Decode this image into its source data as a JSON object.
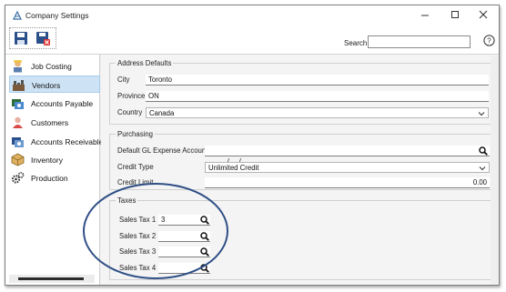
{
  "window": {
    "title": "Company Settings",
    "minimize_icon": "minimize-icon",
    "maximize_icon": "maximize-icon",
    "close_icon": "close-icon"
  },
  "toolbar": {
    "save_icon": "save-icon",
    "save_close_icon": "save-and-close-icon",
    "search_label": "Search",
    "search_value": "",
    "help_icon": "help-icon"
  },
  "sidebar": {
    "items": [
      {
        "label": "Job Costing",
        "icon": "job-costing-icon"
      },
      {
        "label": "Vendors",
        "icon": "vendors-icon",
        "selected": true
      },
      {
        "label": "Accounts Payable",
        "icon": "accounts-payable-icon"
      },
      {
        "label": "Customers",
        "icon": "customers-icon"
      },
      {
        "label": "Accounts Receivable",
        "icon": "accounts-receivable-icon"
      },
      {
        "label": "Inventory",
        "icon": "inventory-icon"
      },
      {
        "label": "Production",
        "icon": "production-icon"
      }
    ]
  },
  "address_defaults": {
    "title": "Address Defaults",
    "city_label": "City",
    "city_value": "Toronto",
    "province_label": "Province",
    "province_value": "ON",
    "country_label": "Country",
    "country_value": "Canada"
  },
  "purchasing": {
    "title": "Purchasing",
    "gl_label": "Default GL Expense Account",
    "gl_value": "  /     /",
    "credit_type_label": "Credit Type",
    "credit_type_value": "Unlimited Credit",
    "credit_limit_label": "Credit Limit",
    "credit_limit_value": "0.00"
  },
  "taxes": {
    "title": "Taxes",
    "rows": [
      {
        "label": "Sales Tax 1",
        "value": "3"
      },
      {
        "label": "Sales Tax 2",
        "value": ""
      },
      {
        "label": "Sales Tax 3",
        "value": ""
      },
      {
        "label": "Sales Tax 4",
        "value": ""
      }
    ]
  },
  "colors": {
    "selection": "#cde3f5",
    "annotation_circle": "#2f4f86"
  }
}
